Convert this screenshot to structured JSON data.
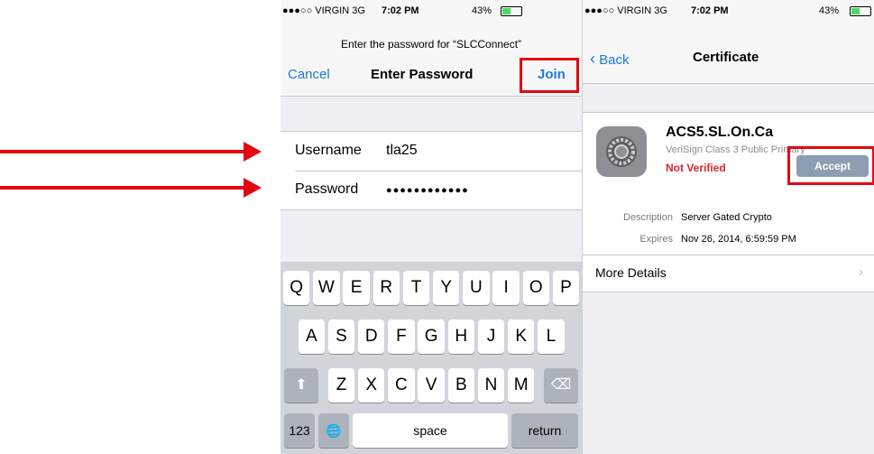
{
  "left": {
    "status": {
      "carrier": "●●●○○ VIRGIN  3G",
      "time": "7:02 PM",
      "battery_pct": "43%",
      "battery_level": 0.43
    },
    "prompt": "Enter the password for “SLCConnect”",
    "nav": {
      "cancel": "Cancel",
      "title": "Enter Password",
      "join": "Join"
    },
    "form": {
      "username_label": "Username",
      "username_value": "tla25",
      "password_label": "Password",
      "password_value": "●●●●●●●●●●●●"
    },
    "keyboard": {
      "row1": [
        "Q",
        "W",
        "E",
        "R",
        "T",
        "Y",
        "U",
        "I",
        "O",
        "P"
      ],
      "row2": [
        "A",
        "S",
        "D",
        "F",
        "G",
        "H",
        "J",
        "K",
        "L"
      ],
      "row3": [
        "Z",
        "X",
        "C",
        "V",
        "B",
        "N",
        "M"
      ],
      "shift": "⬆",
      "delete": "⌫",
      "numbers": "123",
      "globe": "🌐",
      "space": "space",
      "return": "return"
    }
  },
  "right": {
    "status": {
      "carrier": "●●●○○ VIRGIN  3G",
      "time": "7:02 PM",
      "battery_pct": "43%",
      "battery_level": 0.43
    },
    "nav": {
      "back": "Back",
      "title": "Certificate"
    },
    "cert": {
      "name": "ACS5.SL.On.Ca",
      "issuer": "VeriSign Class 3 Public Primary",
      "status": "Not Verified",
      "accept": "Accept"
    },
    "details": {
      "description_label": "Description",
      "description_value": "Server Gated Crypto",
      "expires_label": "Expires",
      "expires_value": "Nov 26, 2014, 6:59:59 PM"
    },
    "more_details": "More Details"
  },
  "colors": {
    "ios_blue": "#1f7ae0",
    "highlight_red": "#e30613",
    "not_verified_red": "#e0222e"
  }
}
